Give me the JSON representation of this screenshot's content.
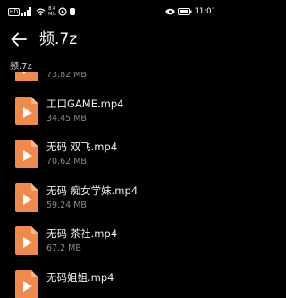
{
  "status_bar": {
    "sim_badge": "HD",
    "net_speed_value": "8.4",
    "net_speed_unit": "M/s",
    "time": "11:01"
  },
  "header": {
    "title": "频.7z"
  },
  "breadcrumb": {
    "path": "频.7z"
  },
  "files": [
    {
      "name": "",
      "size": "73.82 MB"
    },
    {
      "name": "工口GAME.mp4",
      "size": "34.45 MB"
    },
    {
      "name": "无码  双飞.mp4",
      "size": "70.62 MB"
    },
    {
      "name": "无码  痴女学妹.mp4",
      "size": "59.24 MB"
    },
    {
      "name": "无码  茶社.mp4",
      "size": "67.2 MB"
    },
    {
      "name": "无码姐姐.mp4",
      "size": ""
    }
  ],
  "colors": {
    "background": "#000000",
    "file_icon": "#f08a4b",
    "file_icon_fold": "#f7b48a"
  },
  "icons": {
    "back": "arrow-left-icon",
    "file": "video-file-icon",
    "signal": "signal-icon",
    "wifi": "wifi-icon",
    "eye": "eye-icon",
    "battery": "battery-icon"
  }
}
